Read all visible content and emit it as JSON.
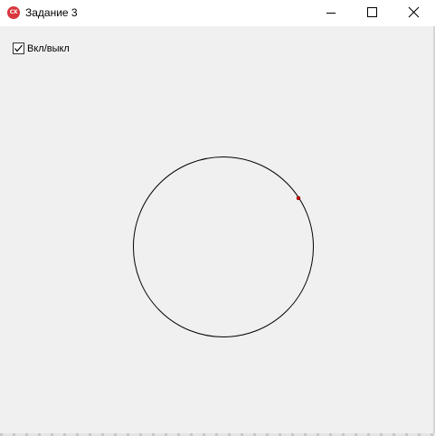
{
  "window": {
    "title": "Задание 3",
    "icon": "app-icon",
    "icon_text": "CX",
    "controls": {
      "minimize_icon": "minimize-icon",
      "maximize_icon": "maximize-icon",
      "close_icon": "close-icon"
    }
  },
  "toggle": {
    "label": "Вкл/выкл",
    "checked": true
  },
  "scene": {
    "circle_color": "#000000",
    "point_color": "#cc0000"
  }
}
